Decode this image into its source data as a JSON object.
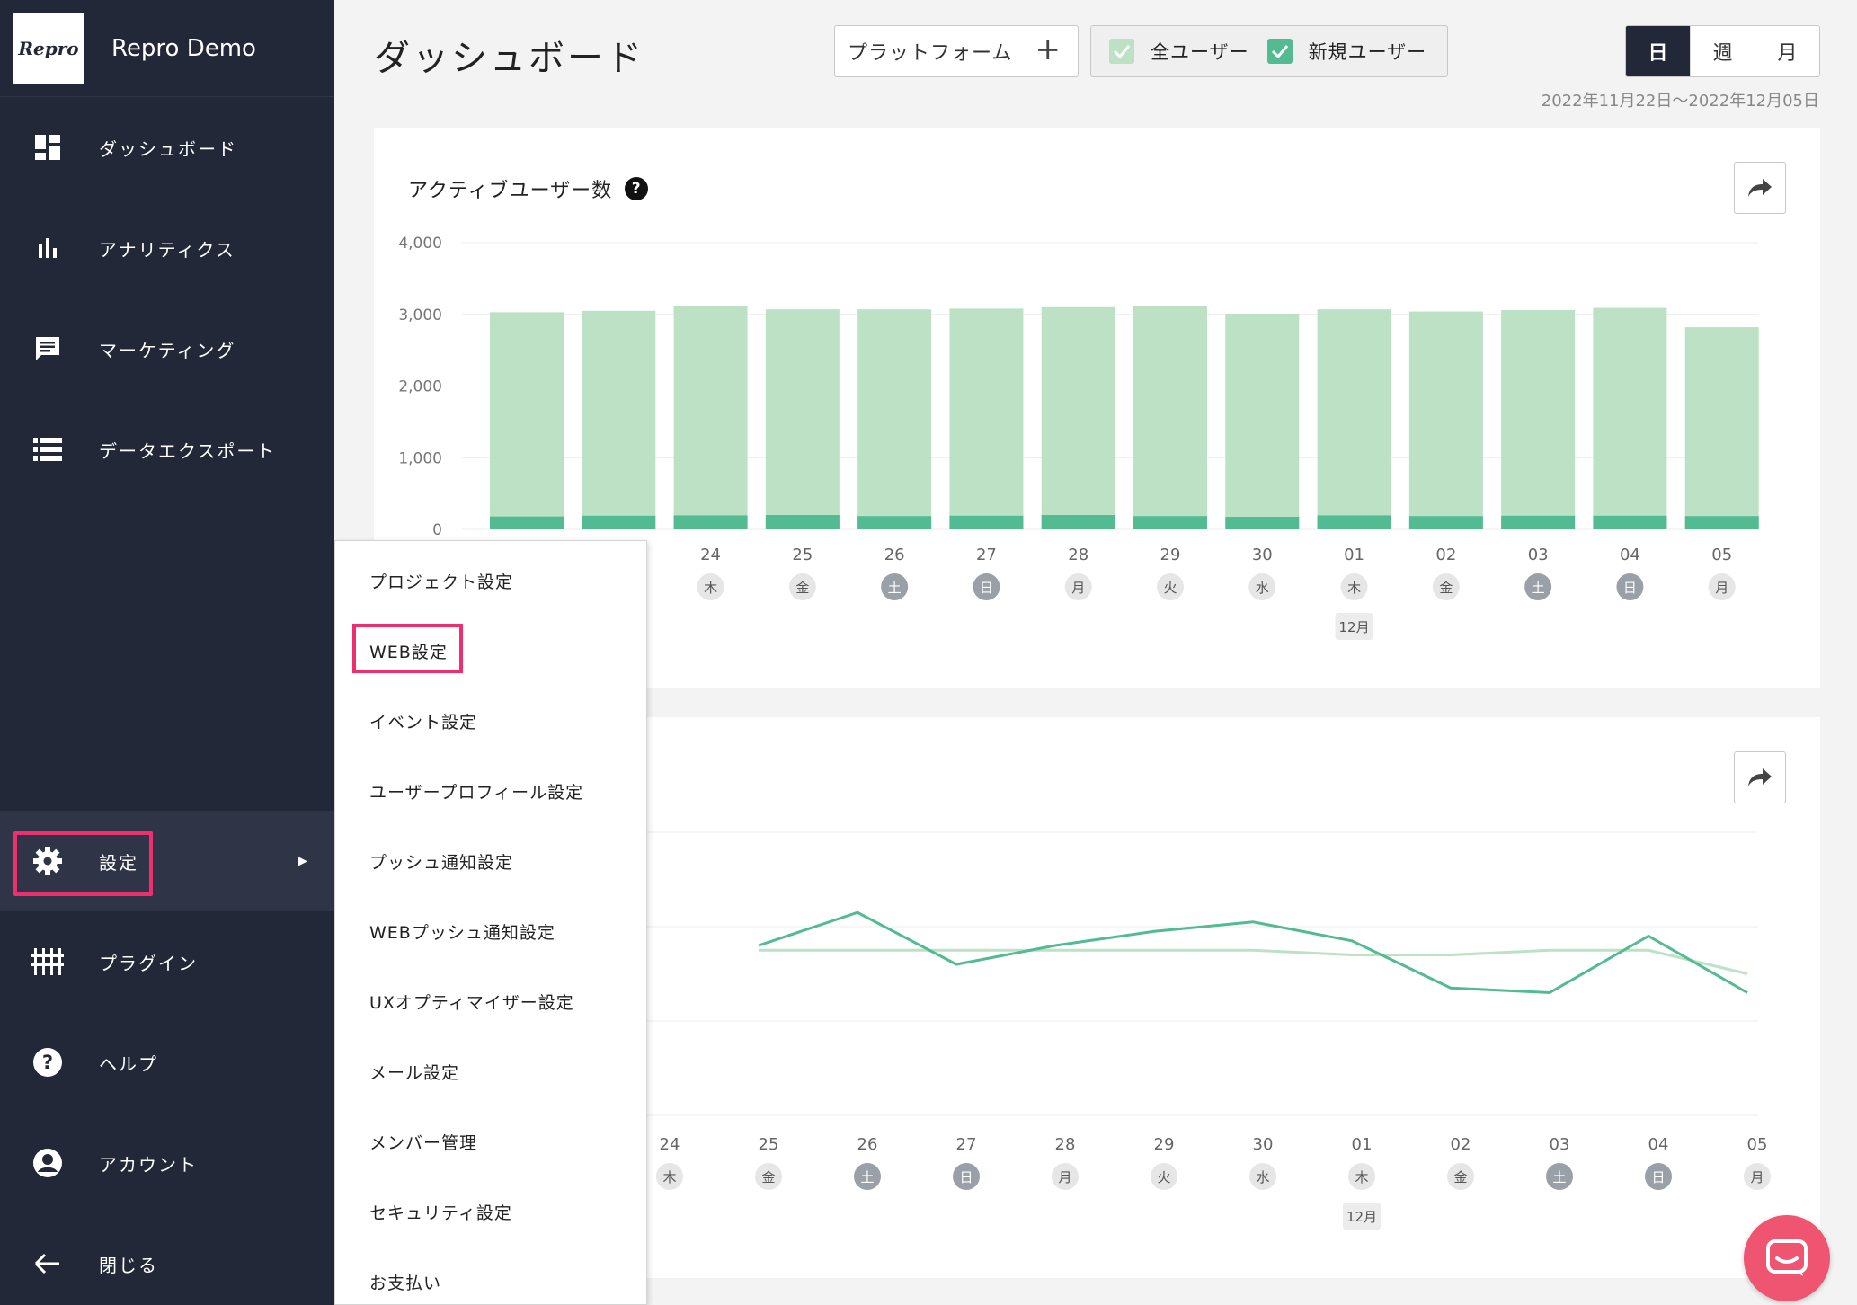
{
  "brand": {
    "logo": "Repro",
    "name": "Repro Demo"
  },
  "sidebar": {
    "items": [
      {
        "label": "ダッシュボード",
        "icon": "dashboard-icon"
      },
      {
        "label": "アナリティクス",
        "icon": "bar-chart-icon"
      },
      {
        "label": "マーケティング",
        "icon": "message-icon"
      },
      {
        "label": "データエクスポート",
        "icon": "list-icon"
      },
      {
        "label": "設定",
        "icon": "gear-icon",
        "active": true
      },
      {
        "label": "プラグイン",
        "icon": "plugin-icon"
      },
      {
        "label": "ヘルプ",
        "icon": "help-icon"
      },
      {
        "label": "アカウント",
        "icon": "account-icon"
      },
      {
        "label": "閉じる",
        "icon": "arrow-left-icon"
      }
    ]
  },
  "header": {
    "title": "ダッシュボード",
    "platform_label": "プラットフォーム",
    "filters": [
      {
        "label": "全ユーザー",
        "checked": true,
        "color": "#b7e0c2"
      },
      {
        "label": "新規ユーザー",
        "checked": true,
        "color": "#4cb88f"
      }
    ],
    "period": [
      "日",
      "週",
      "月"
    ],
    "period_active": "日",
    "date_range": "2022年11月22日〜2022年12月05日"
  },
  "submenu": {
    "items": [
      "プロジェクト設定",
      "WEB設定",
      "イベント設定",
      "ユーザープロフィール設定",
      "プッシュ通知設定",
      "WEBプッシュ通知設定",
      "UXオプティマイザー設定",
      "メール設定",
      "メンバー管理",
      "セキュリティ設定",
      "お支払い"
    ],
    "highlighted": "WEB設定"
  },
  "colors": {
    "sidebar_bg": "#232838",
    "all_users": "#bce1c4",
    "new_users": "#52bb92",
    "highlight": "#ee2f6d"
  },
  "chart_data": [
    {
      "type": "bar",
      "title": "アクティブユーザー数",
      "ylim": [
        0,
        4000
      ],
      "yticks": [
        "4,000",
        "3,000",
        "2,000",
        "1,000",
        "0"
      ],
      "visible_categories": [
        "24",
        "25",
        "26",
        "27",
        "28",
        "29",
        "30",
        "01",
        "02",
        "03",
        "04",
        "05"
      ],
      "visible_weekdays": [
        "木",
        "金",
        "土",
        "日",
        "月",
        "火",
        "水",
        "木",
        "金",
        "土",
        "日",
        "月"
      ],
      "month_label": "12月",
      "series": [
        {
          "name": "全ユーザー",
          "values": [
            3030,
            3050,
            3110,
            3070,
            3070,
            3080,
            3100,
            3110,
            3010,
            3070,
            3040,
            3060,
            3090,
            2820
          ]
        },
        {
          "name": "新規ユーザー",
          "values": [
            180,
            190,
            195,
            200,
            185,
            190,
            200,
            185,
            175,
            195,
            185,
            190,
            190,
            185
          ]
        }
      ]
    },
    {
      "type": "line",
      "visible_categories": [
        "24",
        "25",
        "26",
        "27",
        "28",
        "29",
        "30",
        "01",
        "02",
        "03",
        "04",
        "05"
      ],
      "visible_weekdays": [
        "木",
        "金",
        "土",
        "日",
        "月",
        "火",
        "水",
        "木",
        "金",
        "土",
        "日",
        "月"
      ],
      "month_label": "12月",
      "series": [
        {
          "name": "全ユーザー",
          "values": [
            null,
            null,
            0.52,
            0.52,
            0.52,
            0.52,
            0.52,
            0.52,
            0.51,
            0.51,
            0.52,
            0.52,
            0.47
          ]
        },
        {
          "name": "新規ユーザー",
          "values": [
            null,
            null,
            0.53,
            0.6,
            0.49,
            0.53,
            0.56,
            0.58,
            0.54,
            0.44,
            0.43,
            0.55,
            0.43
          ]
        }
      ]
    }
  ]
}
